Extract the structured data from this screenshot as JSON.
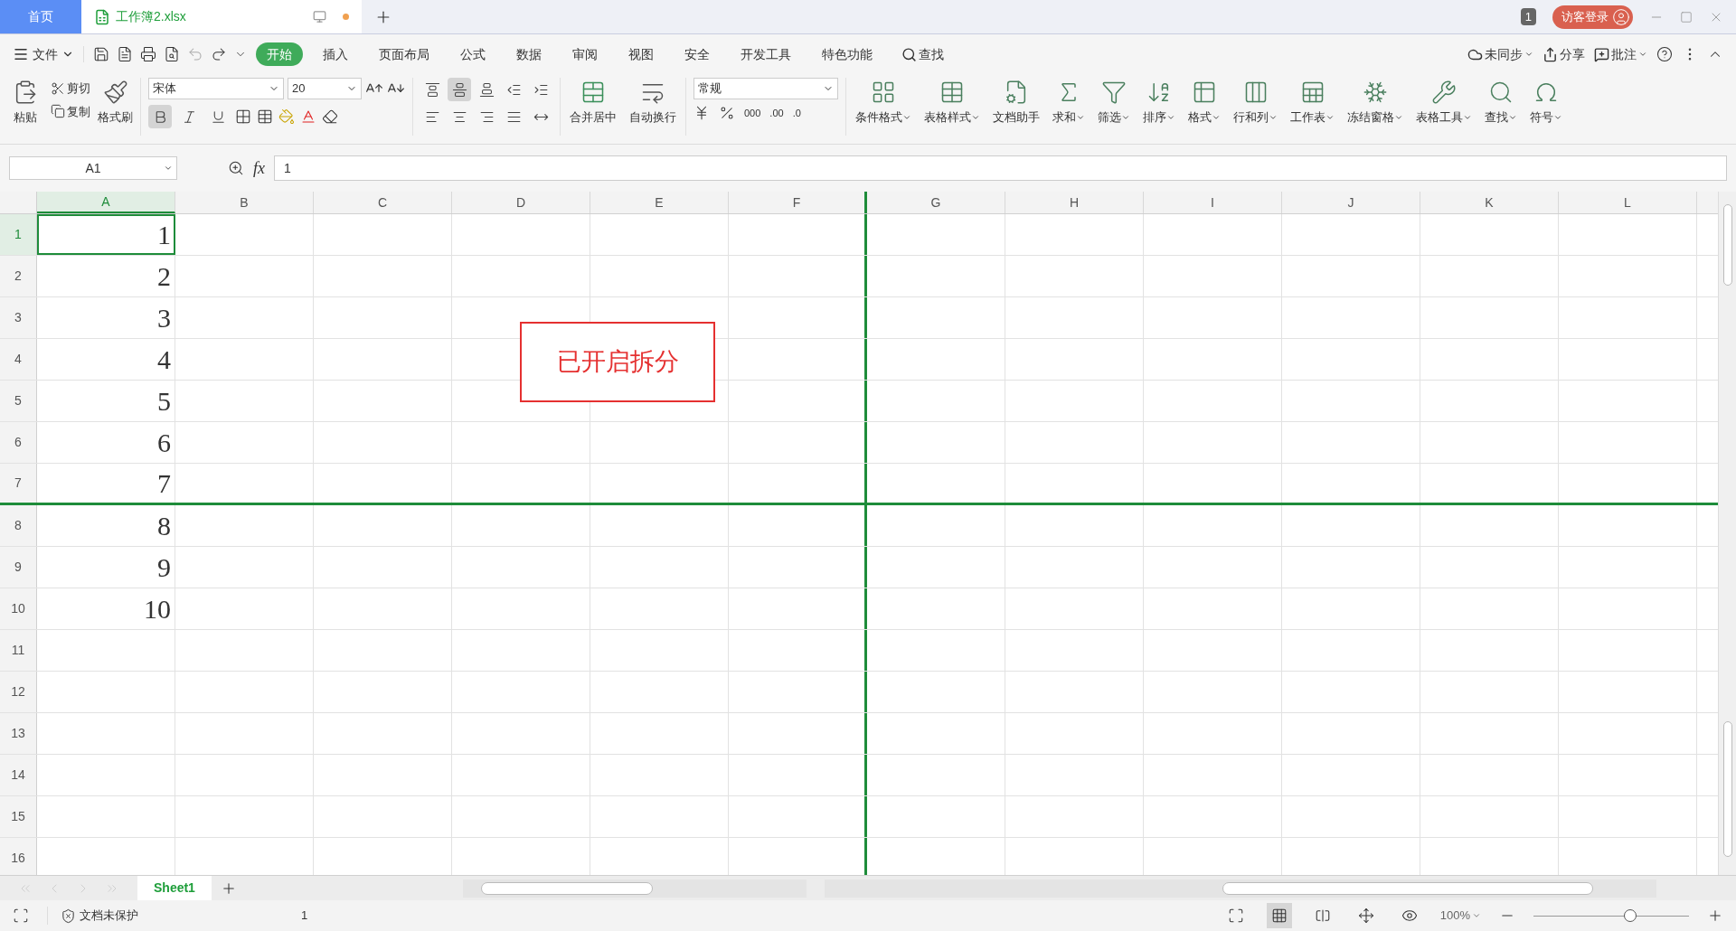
{
  "tabs": [
    {
      "kind": "home",
      "label": "首页",
      "selected": false
    },
    {
      "kind": "file",
      "label": "工作簿2.xlsx",
      "selected": true
    }
  ],
  "title_bar": {
    "window_count": "1",
    "login": "访客登录"
  },
  "menu": {
    "file": "文件",
    "items": [
      {
        "label": "开始",
        "selected": true
      },
      {
        "label": "插入",
        "selected": false
      },
      {
        "label": "页面布局",
        "selected": false
      },
      {
        "label": "公式",
        "selected": false
      },
      {
        "label": "数据",
        "selected": false
      },
      {
        "label": "审阅",
        "selected": false
      },
      {
        "label": "视图",
        "selected": false
      },
      {
        "label": "安全",
        "selected": false
      },
      {
        "label": "开发工具",
        "selected": false
      },
      {
        "label": "特色功能",
        "selected": false
      }
    ],
    "search": "查找",
    "sync": "未同步",
    "share": "分享",
    "comment": "批注"
  },
  "ribbon": {
    "cut": "剪切",
    "copy": "复制",
    "paste": "粘贴",
    "painter": "格式刷",
    "font_name": "宋体",
    "font_size": "20",
    "bold": true,
    "italic": false,
    "underline": false,
    "align": [
      {
        "kind": "top",
        "selected": false
      },
      {
        "kind": "middle",
        "selected": true
      },
      {
        "kind": "bottom",
        "selected": false
      },
      {
        "kind": "outdent",
        "selected": false
      },
      {
        "kind": "indent",
        "selected": false
      },
      {
        "kind": "left",
        "selected": false
      },
      {
        "kind": "center",
        "selected": false
      },
      {
        "kind": "right",
        "selected": false
      },
      {
        "kind": "justify",
        "selected": false
      },
      {
        "kind": "distribute",
        "selected": false
      }
    ],
    "merge": "合并居中",
    "wrap": "自动换行",
    "number_format": "常规",
    "thousands": "000",
    "add_decimal": ".00",
    "remove_decimal": ".0",
    "tools": [
      {
        "kind": "conditional",
        "label": "条件格式",
        "dropdown": true
      },
      {
        "kind": "table_style",
        "label": "表格样式",
        "dropdown": true
      },
      {
        "kind": "assistant",
        "label": "文档助手",
        "dropdown": false
      },
      {
        "kind": "sum",
        "label": "求和",
        "dropdown": true
      },
      {
        "kind": "filter",
        "label": "筛选",
        "dropdown": true
      },
      {
        "kind": "sort",
        "label": "排序",
        "dropdown": true
      },
      {
        "kind": "format",
        "label": "格式",
        "dropdown": true
      },
      {
        "kind": "rows_cols",
        "label": "行和列",
        "dropdown": true
      },
      {
        "kind": "sheet",
        "label": "工作表",
        "dropdown": true
      },
      {
        "kind": "freeze",
        "label": "冻结窗格",
        "dropdown": true
      },
      {
        "kind": "table_tools",
        "label": "表格工具",
        "dropdown": true
      },
      {
        "kind": "find",
        "label": "查找",
        "dropdown": true
      },
      {
        "kind": "symbol",
        "label": "符号",
        "dropdown": true
      }
    ]
  },
  "formula_bar": {
    "cell_ref": "A1",
    "fx": "fx",
    "value": "1"
  },
  "columns": [
    {
      "label": "A",
      "selected": true,
      "split_right": false
    },
    {
      "label": "B",
      "selected": false,
      "split_right": false
    },
    {
      "label": "C",
      "selected": false,
      "split_right": false
    },
    {
      "label": "D",
      "selected": false,
      "split_right": false
    },
    {
      "label": "E",
      "selected": false,
      "split_right": false
    },
    {
      "label": "F",
      "selected": false,
      "split_right": true
    },
    {
      "label": "G",
      "selected": false,
      "split_right": false
    },
    {
      "label": "H",
      "selected": false,
      "split_right": false
    },
    {
      "label": "I",
      "selected": false,
      "split_right": false
    },
    {
      "label": "J",
      "selected": false,
      "split_right": false
    },
    {
      "label": "K",
      "selected": false,
      "split_right": false
    },
    {
      "label": "L",
      "selected": false,
      "split_right": false
    }
  ],
  "rows": [
    {
      "header": "1",
      "selected": true,
      "split_below": false,
      "cells": [
        {
          "value": "1",
          "selected": true
        }
      ]
    },
    {
      "header": "2",
      "selected": false,
      "split_below": false,
      "cells": [
        {
          "value": "2",
          "selected": false
        }
      ]
    },
    {
      "header": "3",
      "selected": false,
      "split_below": false,
      "cells": [
        {
          "value": "3",
          "selected": false
        }
      ]
    },
    {
      "header": "4",
      "selected": false,
      "split_below": false,
      "cells": [
        {
          "value": "4",
          "selected": false
        }
      ]
    },
    {
      "header": "5",
      "selected": false,
      "split_below": false,
      "cells": [
        {
          "value": "5",
          "selected": false
        }
      ]
    },
    {
      "header": "6",
      "selected": false,
      "split_below": false,
      "cells": [
        {
          "value": "6",
          "selected": false
        }
      ]
    },
    {
      "header": "7",
      "selected": false,
      "split_below": true,
      "cells": [
        {
          "value": "7",
          "selected": false
        }
      ]
    },
    {
      "header": "8",
      "selected": false,
      "split_below": false,
      "cells": [
        {
          "value": "8",
          "selected": false
        }
      ]
    },
    {
      "header": "9",
      "selected": false,
      "split_below": false,
      "cells": [
        {
          "value": "9",
          "selected": false
        }
      ]
    },
    {
      "header": "10",
      "selected": false,
      "split_below": false,
      "cells": [
        {
          "value": "10",
          "selected": false
        }
      ]
    },
    {
      "header": "11",
      "selected": false,
      "split_below": false
    },
    {
      "header": "12",
      "selected": false,
      "split_below": false
    },
    {
      "header": "13",
      "selected": false,
      "split_below": false
    },
    {
      "header": "14",
      "selected": false,
      "split_below": false
    },
    {
      "header": "15",
      "selected": false,
      "split_below": false
    },
    {
      "header": "16",
      "selected": false,
      "split_below": false
    }
  ],
  "annotation": "已开启拆分",
  "sheets": [
    {
      "name": "Sheet1",
      "selected": true
    }
  ],
  "status_bar": {
    "protection": "文档未保护",
    "value": "1",
    "view_modes": [
      {
        "kind": "fullscreen",
        "selected": false
      },
      {
        "kind": "normal",
        "selected": true
      },
      {
        "kind": "page_break",
        "selected": false
      },
      {
        "kind": "reading",
        "selected": false
      },
      {
        "kind": "eye",
        "selected": false
      }
    ],
    "zoom": "100%",
    "level": 0.62
  }
}
